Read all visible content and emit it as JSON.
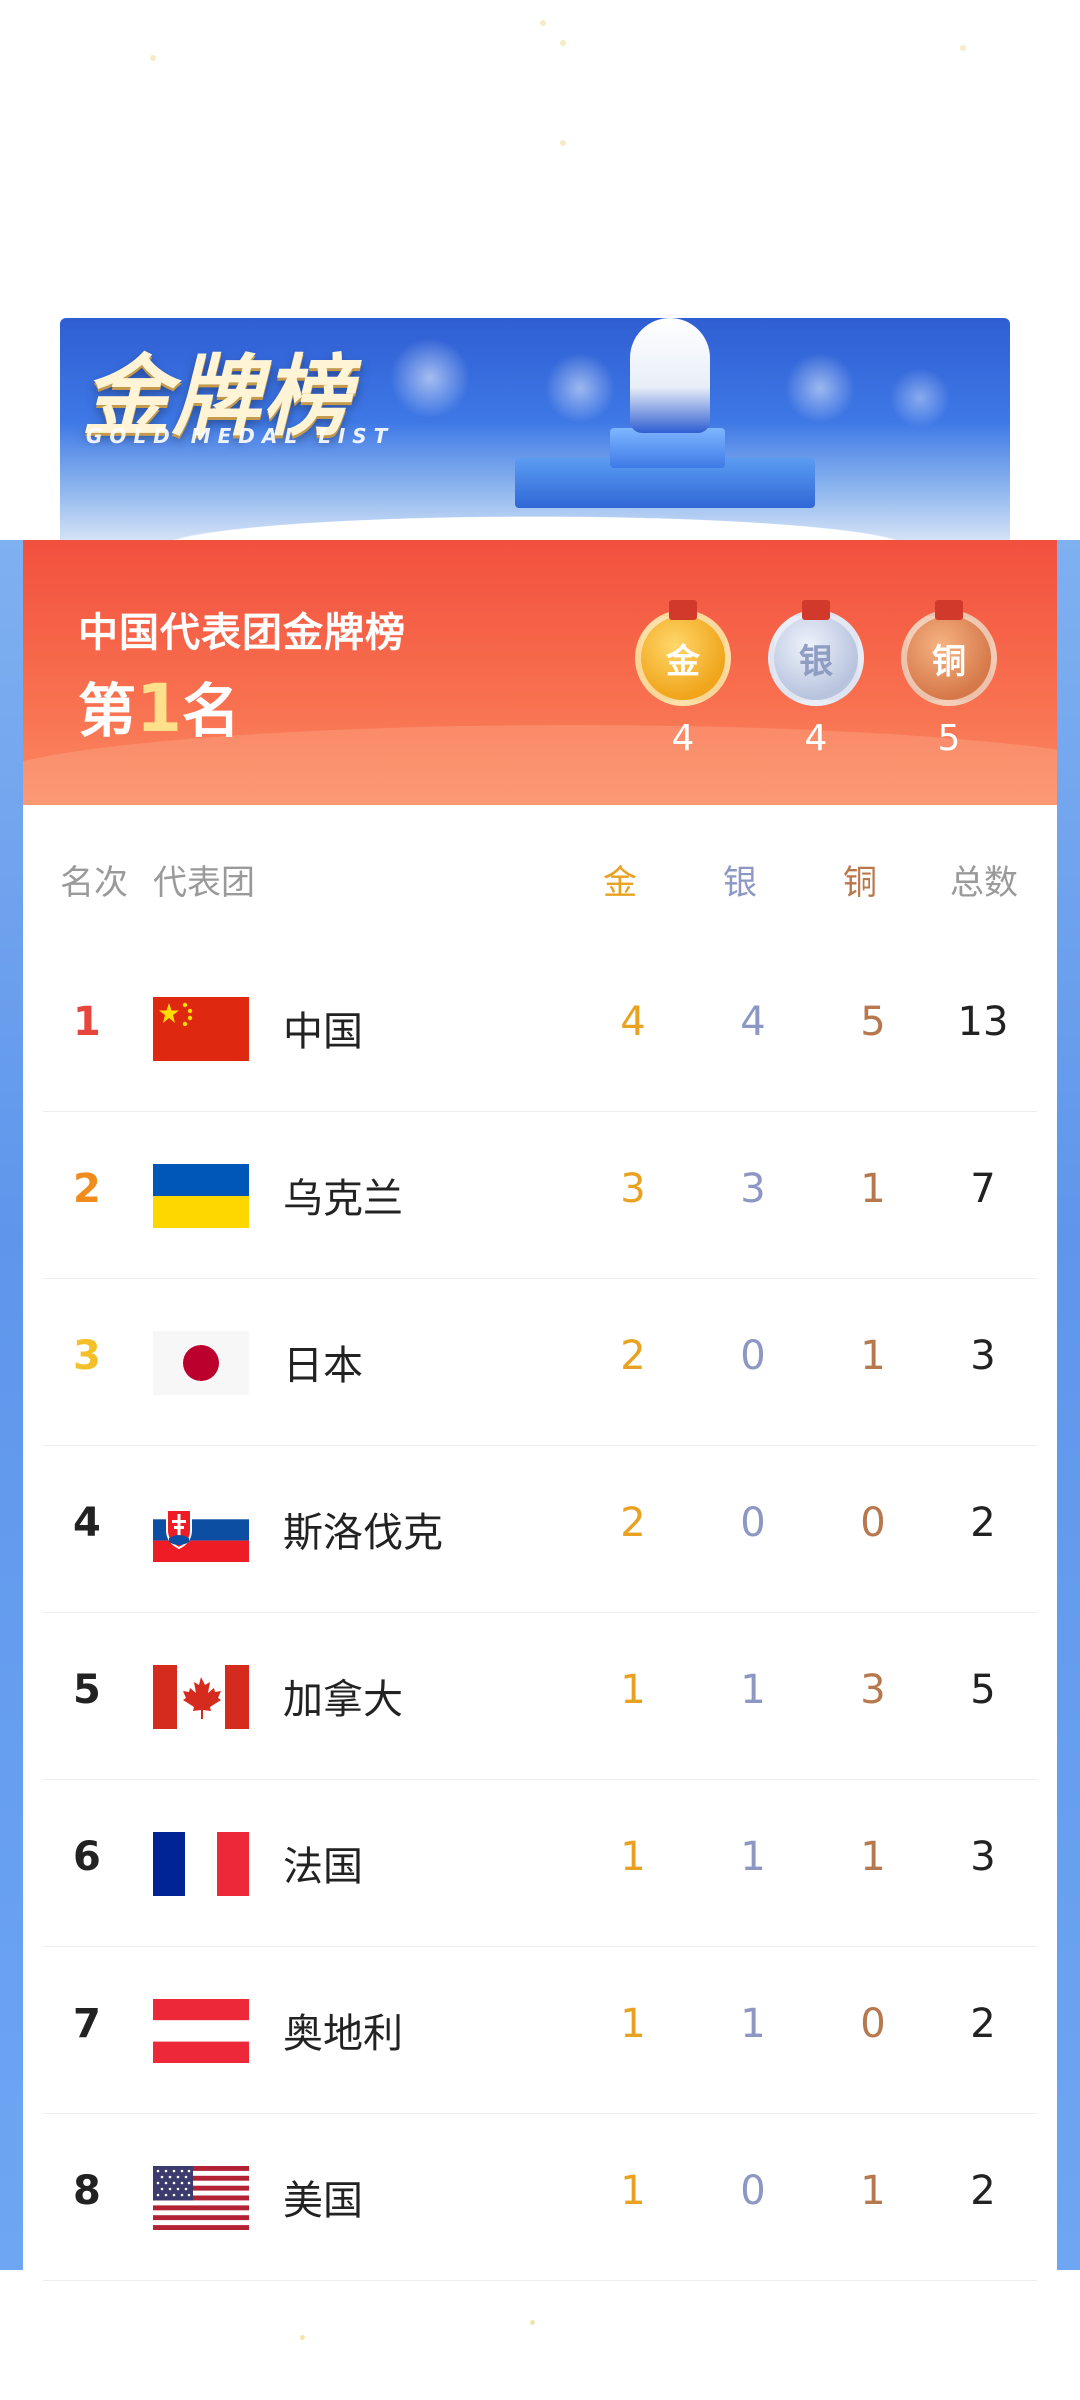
{
  "banner": {
    "title": "金牌榜",
    "subtitle": "GOLD MEDAL LIST"
  },
  "summary": {
    "title": "中国代表团金牌榜",
    "rank_prefix": "第",
    "rank_value": "1",
    "rank_suffix": "名",
    "medals": {
      "gold_label": "金",
      "silver_label": "银",
      "bronze_label": "铜",
      "gold_count": "4",
      "silver_count": "4",
      "bronze_count": "5"
    }
  },
  "table": {
    "headers": {
      "rank": "名次",
      "team": "代表团",
      "gold": "金",
      "silver": "银",
      "bronze": "铜",
      "total": "总数"
    },
    "rows": [
      {
        "rank": "1",
        "team": "中国",
        "gold": "4",
        "silver": "4",
        "bronze": "5",
        "total": "13",
        "rank_color": "#e8453c",
        "flag": "china-flag-icon"
      },
      {
        "rank": "2",
        "team": "乌克兰",
        "gold": "3",
        "silver": "3",
        "bronze": "1",
        "total": "7",
        "rank_color": "#f08c1e",
        "flag": "ukraine-flag-icon"
      },
      {
        "rank": "3",
        "team": "日本",
        "gold": "2",
        "silver": "0",
        "bronze": "1",
        "total": "3",
        "rank_color": "#f4c02a",
        "flag": "japan-flag-icon"
      },
      {
        "rank": "4",
        "team": "斯洛伐克",
        "gold": "2",
        "silver": "0",
        "bronze": "0",
        "total": "2",
        "rank_color": "#222222",
        "flag": "slovakia-flag-icon"
      },
      {
        "rank": "5",
        "team": "加拿大",
        "gold": "1",
        "silver": "1",
        "bronze": "3",
        "total": "5",
        "rank_color": "#222222",
        "flag": "canada-flag-icon"
      },
      {
        "rank": "6",
        "team": "法国",
        "gold": "1",
        "silver": "1",
        "bronze": "1",
        "total": "3",
        "rank_color": "#222222",
        "flag": "france-flag-icon"
      },
      {
        "rank": "7",
        "team": "奥地利",
        "gold": "1",
        "silver": "1",
        "bronze": "0",
        "total": "2",
        "rank_color": "#222222",
        "flag": "austria-flag-icon"
      },
      {
        "rank": "8",
        "team": "美国",
        "gold": "1",
        "silver": "0",
        "bronze": "1",
        "total": "2",
        "rank_color": "#222222",
        "flag": "usa-flag-icon"
      }
    ]
  },
  "colors": {
    "gold": "#e9a122",
    "silver": "#8d97c4",
    "bronze": "#b8784d",
    "card_red": "#f2503e",
    "frame_blue": "#5f96ec"
  }
}
